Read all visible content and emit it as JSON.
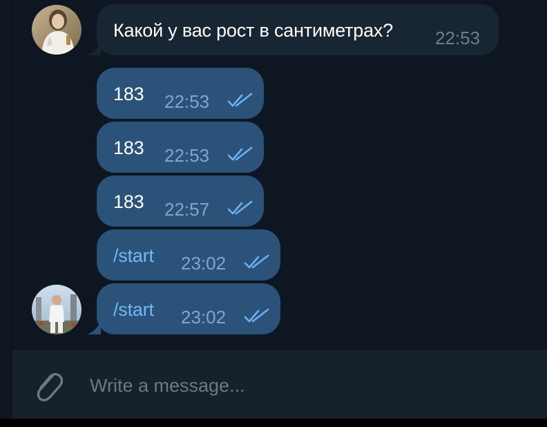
{
  "messages": [
    {
      "direction": "in",
      "text": "Какой у вас рост в сантиметрах?",
      "time": "22:53"
    },
    {
      "direction": "out",
      "text": "183",
      "time": "22:53",
      "status": "read"
    },
    {
      "direction": "out",
      "text": "183",
      "time": "22:53",
      "status": "read"
    },
    {
      "direction": "out",
      "text": "183",
      "time": "22:57",
      "status": "read"
    },
    {
      "direction": "out",
      "text": "/start",
      "time": "23:02",
      "status": "read"
    },
    {
      "direction": "out",
      "text": "/start",
      "time": "23:02",
      "status": "read"
    }
  ],
  "composer": {
    "placeholder": "Write a message...",
    "value": "",
    "attach_icon": "paperclip-icon"
  },
  "colors": {
    "background": "#0e1621",
    "incoming_bubble": "#182533",
    "outgoing_bubble": "#2b5278",
    "command_text": "#71b9f4",
    "read_check": "#6cb2f0"
  }
}
